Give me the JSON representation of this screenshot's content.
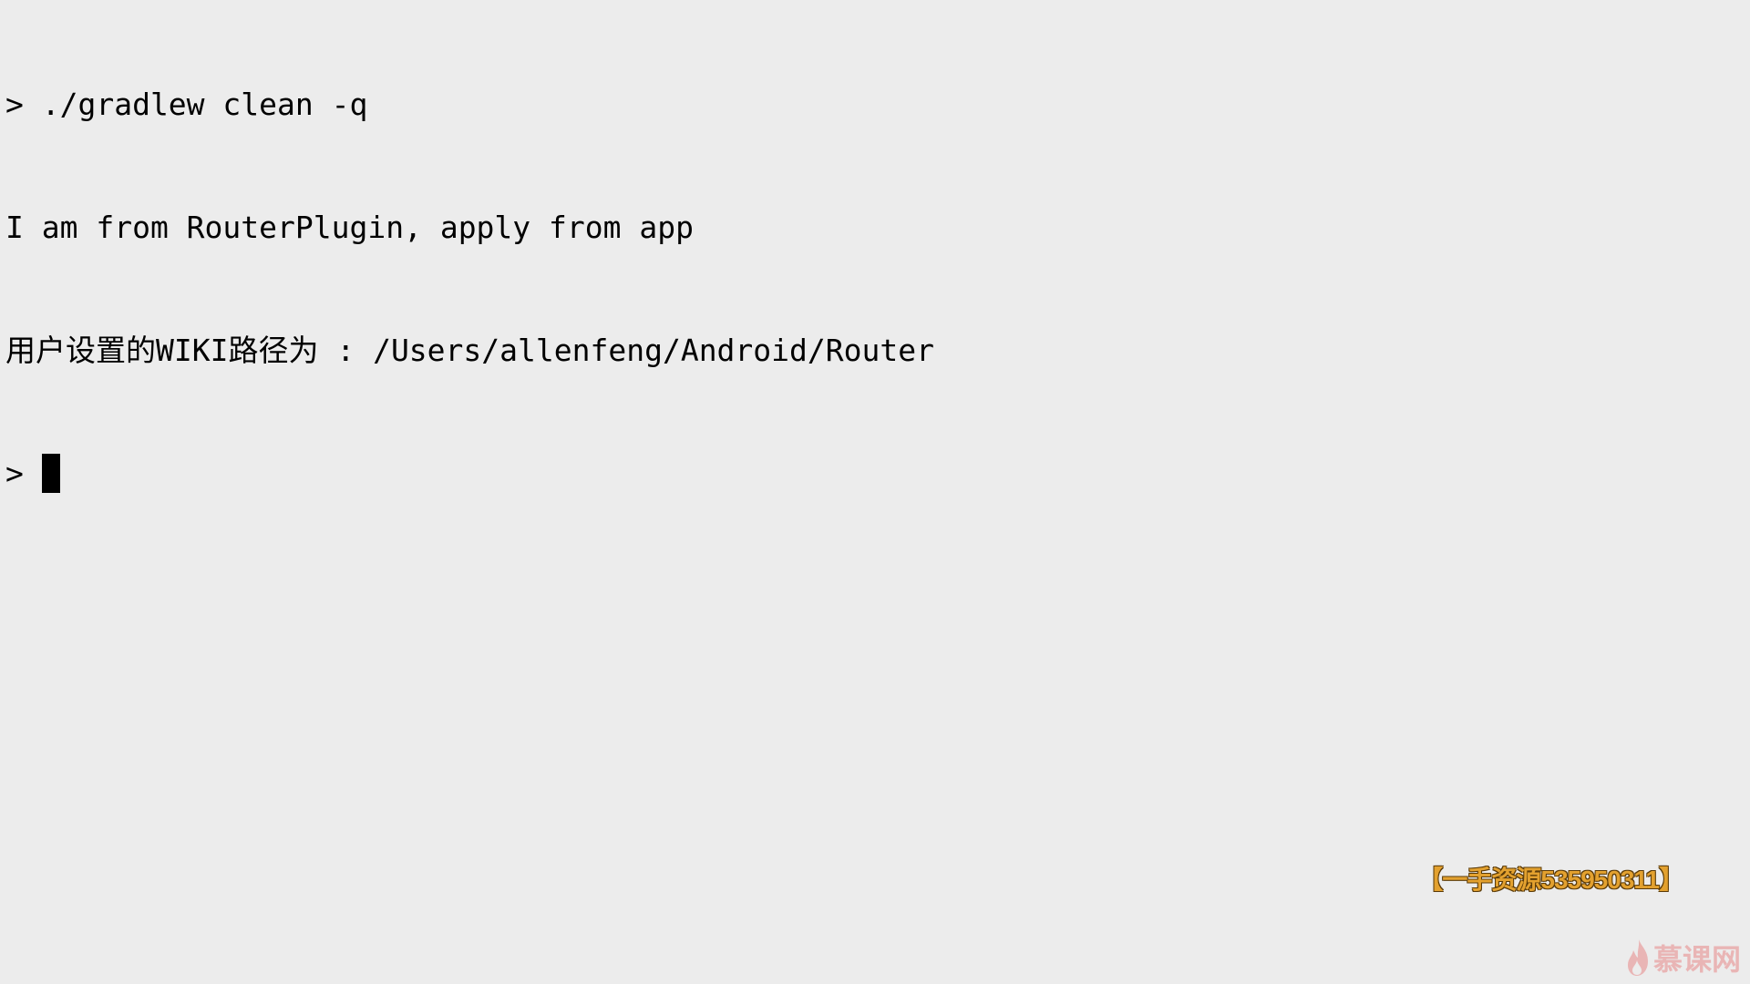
{
  "colors": {
    "background": "#ececec",
    "text": "#000000",
    "cursor": "#000000"
  },
  "terminal": {
    "lines": [
      {
        "prompt": ">",
        "text": "./gradlew clean -q"
      },
      {
        "text": "I am from RouterPlugin, apply from app"
      },
      {
        "text": "用户设置的WIKI路径为 : /Users/allenfeng/Android/Router"
      },
      {
        "prompt": ">"
      }
    ]
  },
  "watermark": {
    "text": "【一手资源535950311】",
    "color": "#e3a12f"
  },
  "logo": {
    "text": "慕课网",
    "icon": "flame-icon",
    "color": "#e9a3a3"
  }
}
